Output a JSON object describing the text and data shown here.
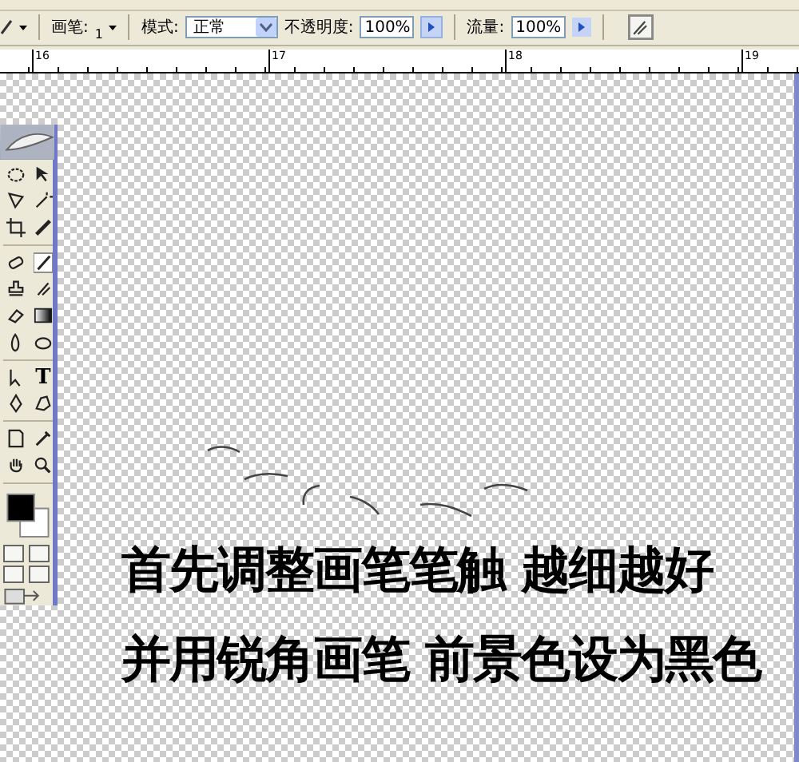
{
  "options_bar": {
    "brush_label": "画笔:",
    "brush_size": "1",
    "mode_label": "模式:",
    "mode_value": "正常",
    "opacity_label": "不透明度:",
    "opacity_value": "100%",
    "flow_label": "流量:",
    "flow_value": "100%"
  },
  "ruler": {
    "labels": [
      "16",
      "17",
      "18",
      "19"
    ]
  },
  "toolbox": {
    "text_tool_glyph": "T"
  },
  "caption_lines": [
    "首先调整画笔笔触 越细越好",
    "并用锐角画笔 前景色设为黑色"
  ]
}
